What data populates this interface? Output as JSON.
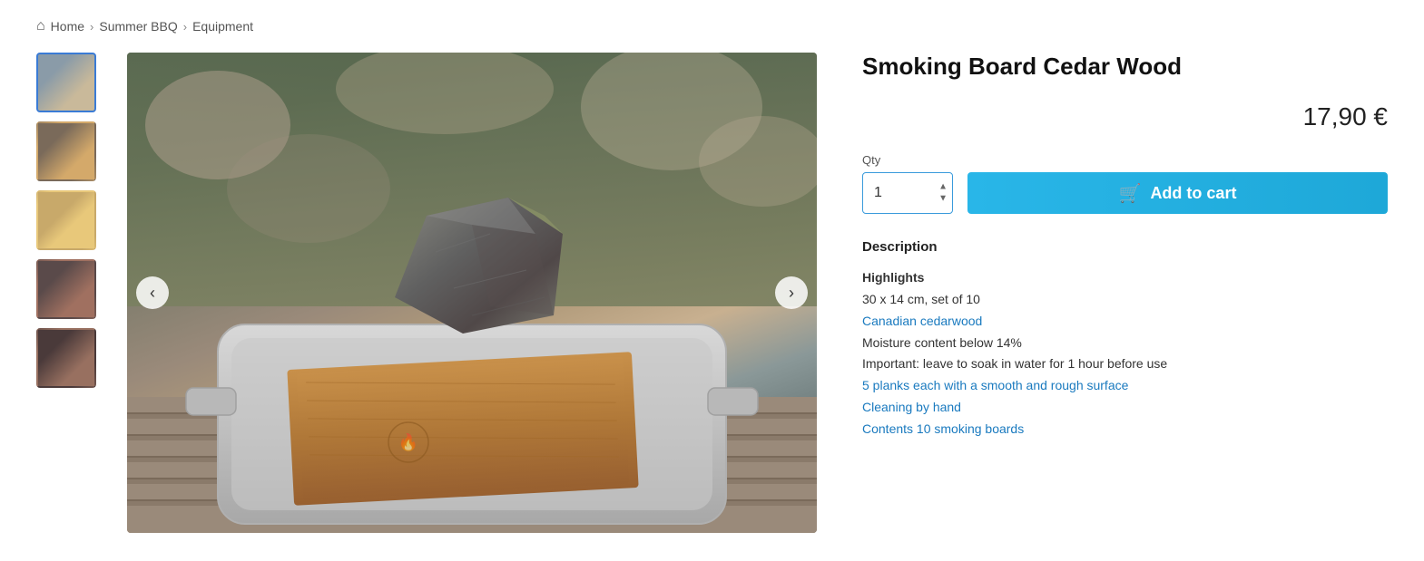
{
  "breadcrumb": {
    "home_label": "Home",
    "separator1": "›",
    "link1_label": "Summer BBQ",
    "separator2": "›",
    "link2_label": "Equipment"
  },
  "product": {
    "title": "Smoking Board Cedar Wood",
    "price": "17,90 €",
    "qty_label": "Qty",
    "qty_value": "1",
    "add_to_cart_label": "Add to cart",
    "description_title": "Description",
    "highlights_label": "Highlights",
    "description_items": [
      {
        "text": "Highlights",
        "style": "heading"
      },
      {
        "text": "30 x 14 cm, set of 10",
        "style": "normal"
      },
      {
        "text": "Canadian cedarwood",
        "style": "blue"
      },
      {
        "text": "Moisture content below 14%",
        "style": "normal"
      },
      {
        "text": "Important: leave to soak in water for 1 hour before use",
        "style": "normal"
      },
      {
        "text": "5 planks each with a smooth and rough surface",
        "style": "blue"
      },
      {
        "text": "Cleaning by hand",
        "style": "blue"
      },
      {
        "text": "Contents 10 smoking boards",
        "style": "blue"
      }
    ]
  },
  "thumbnails": [
    {
      "id": 1,
      "active": true,
      "css_class": "thumb-1"
    },
    {
      "id": 2,
      "active": false,
      "css_class": "thumb-2"
    },
    {
      "id": 3,
      "active": false,
      "css_class": "thumb-3"
    },
    {
      "id": 4,
      "active": false,
      "css_class": "thumb-4"
    },
    {
      "id": 5,
      "active": false,
      "css_class": "thumb-5"
    }
  ],
  "nav": {
    "prev_arrow": "‹",
    "next_arrow": "›"
  }
}
